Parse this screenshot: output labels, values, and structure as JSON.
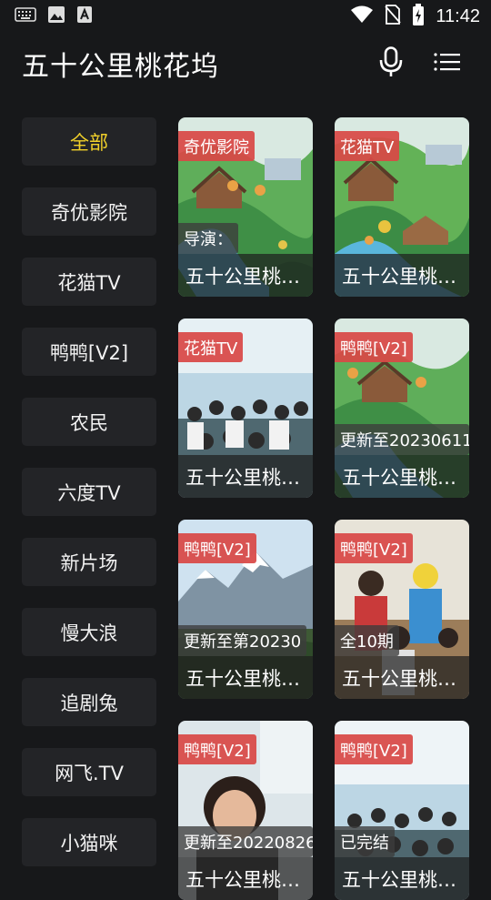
{
  "status": {
    "time": "11:42"
  },
  "app": {
    "title": "五十公里桃花坞"
  },
  "sidebar": {
    "items": [
      {
        "label": "全部",
        "active": true
      },
      {
        "label": "奇优影院"
      },
      {
        "label": "花猫TV"
      },
      {
        "label": "鸭鸭[V2]"
      },
      {
        "label": "农民"
      },
      {
        "label": "六度TV"
      },
      {
        "label": "新片场"
      },
      {
        "label": "慢大浪"
      },
      {
        "label": "追剧兔"
      },
      {
        "label": "网飞.TV"
      },
      {
        "label": "小猫咪"
      }
    ]
  },
  "results": [
    {
      "source": "奇优影院",
      "note": "导演：",
      "title": "五十公里桃花坞",
      "poster": "illustration"
    },
    {
      "source": "花猫TV",
      "note": "",
      "title": "五十公里桃花坞",
      "poster": "illustration"
    },
    {
      "source": "花猫TV",
      "note": "",
      "title": "五十公里桃花坞",
      "poster": "group-beach"
    },
    {
      "source": "鸭鸭[V2]",
      "note": "更新至20230611",
      "title": "五十公里桃花坞",
      "poster": "illustration"
    },
    {
      "source": "鸭鸭[V2]",
      "note": "更新至第20230",
      "title": "五十公里桃花坞",
      "poster": "mountain"
    },
    {
      "source": "鸭鸭[V2]",
      "note": "全10期",
      "title": "五十公里桃花坞",
      "poster": "people"
    },
    {
      "source": "鸭鸭[V2]",
      "note": "更新至20220826",
      "title": "五十公里桃花坞",
      "poster": "portrait"
    },
    {
      "source": "鸭鸭[V2]",
      "note": "已完结",
      "title": "五十公里桃花坞",
      "poster": "group-beach"
    }
  ],
  "colors": {
    "background": "#17181a",
    "tag": "#d84846",
    "active": "#f2d12a"
  }
}
